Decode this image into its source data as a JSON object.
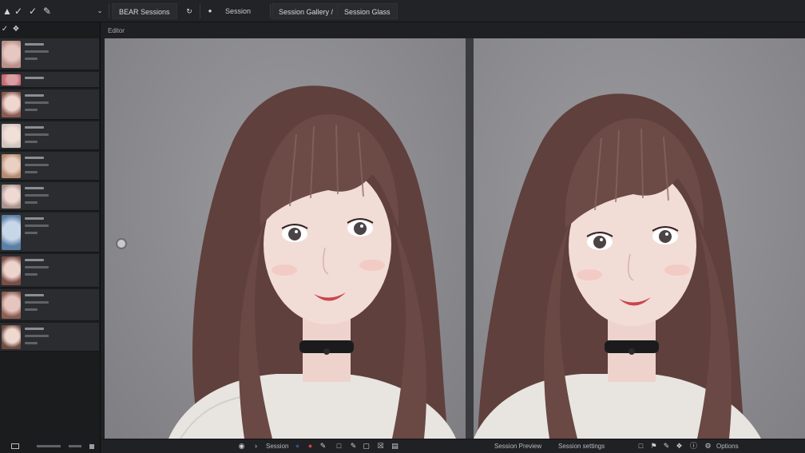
{
  "toolbar": {
    "icons": [
      "logo-a-icon",
      "checkmark-icon",
      "brush-icon",
      "chevron-down-icon",
      "settings-icon",
      "pin-icon"
    ],
    "tab_primary": "BEAR Sessions",
    "label_secondary": "Session",
    "tab_compare": "Session Gallery /",
    "tab_compare_2": "Session Glass"
  },
  "left_panel": {
    "items": [
      {
        "thumb": "portrait-1"
      },
      {
        "thumb": "portrait-2"
      },
      {
        "thumb": "portrait-3"
      },
      {
        "thumb": "portrait-4"
      },
      {
        "thumb": "portrait-5"
      },
      {
        "thumb": "portrait-6"
      },
      {
        "thumb": "portrait-7"
      },
      {
        "thumb": "portrait-8"
      },
      {
        "thumb": "portrait-9"
      },
      {
        "thumb": "portrait-10"
      }
    ]
  },
  "workspace": {
    "label": "Editor"
  },
  "bottom_bar": {
    "status_left": "Session",
    "status_right_1": "Session Preview",
    "status_right_2": "Session settings",
    "status_right_3": "Options"
  },
  "colors": {
    "background": "#1e1f21",
    "panel": "#2a2c2f",
    "canvas": "#8d8c91",
    "hair": "#6b4a45",
    "skin": "#f3dcd6",
    "choker": "#1a1a1c",
    "sweater": "#e9e6e2"
  }
}
